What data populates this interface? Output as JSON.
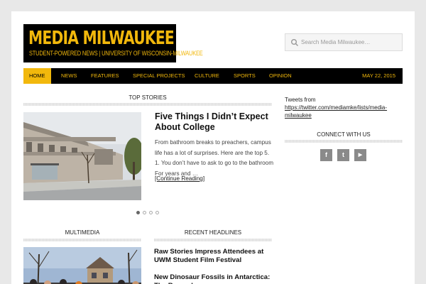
{
  "site": {
    "title": "MEDIA MILWAUKEE",
    "tagline": "STUDENT-POWERED NEWS | UNIVERSITY OF WISCONSIN-MILWAUKEE"
  },
  "search": {
    "placeholder": "Search Media Milwaukee…",
    "icon": "search-icon"
  },
  "nav": {
    "items": [
      {
        "label": "HOME",
        "active": true
      },
      {
        "label": "NEWS"
      },
      {
        "label": "FEATURES"
      },
      {
        "label": "SPECIAL PROJECTS"
      },
      {
        "label": "CULTURE"
      },
      {
        "label": "SPORTS"
      },
      {
        "label": "OPINION"
      }
    ],
    "date": "MAY 22, 2015"
  },
  "top_stories": {
    "heading": "TOP STORIES",
    "story": {
      "title": "Five Things I Didn’t Expect About College",
      "excerpt": "From bathroom breaks to preachers, campus life has a lot of surprises. Here are the top 5. 1. You don’t have to ask to go to the bathroom For years and …",
      "more": "[Continue Reading]"
    },
    "slides": 4,
    "active_slide": 1
  },
  "sidebar": {
    "tweets_label": "Tweets from",
    "tweets_link": "https://twitter.com/mediamke/lists/media-milwaukee",
    "connect_heading": "CONNECT WITH US",
    "social": [
      {
        "icon": "facebook-icon",
        "glyph": "f"
      },
      {
        "icon": "twitter-icon",
        "glyph": "t"
      },
      {
        "icon": "youtube-icon",
        "glyph": "▶"
      }
    ]
  },
  "multimedia": {
    "heading": "MULTIMEDIA"
  },
  "recent": {
    "heading": "RECENT HEADLINES",
    "headlines": [
      "Raw Stories Impress Attendees at UWM Student Film Festival",
      "New Dinosaur Fossils in Antarctica: The Beyond"
    ]
  },
  "colors": {
    "accent": "#f2b80c",
    "nav_bg": "#000000",
    "social_bg": "#8a8a8a"
  }
}
